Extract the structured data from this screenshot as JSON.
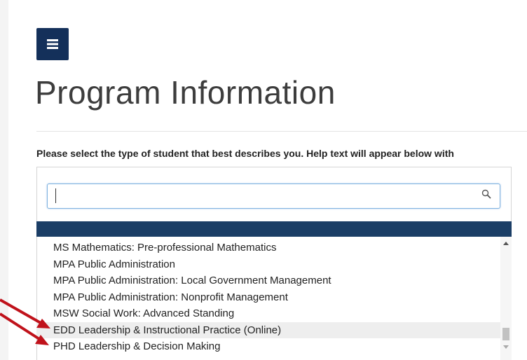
{
  "header": {
    "menu_icon": "hamburger-menu-icon",
    "title": "Program Information"
  },
  "form": {
    "prompt": "Please select the type of student that best describes you. Help text will appear below with",
    "search": {
      "value": "",
      "placeholder": "",
      "icon": "search-icon"
    }
  },
  "dropdown": {
    "items": [
      "MS Mathematics: Pre-professional Mathematics",
      "MPA Public Administration",
      "MPA Public Administration: Local Government Management",
      "MPA Public Administration: Nonprofit Management",
      "MSW Social Work: Advanced Standing",
      "EDD Leadership & Instructional Practice (Online)",
      "PHD Leadership & Decision Making"
    ],
    "hovered_index": 5
  },
  "colors": {
    "menu_button": "#14305a",
    "highlight_bar": "#1b3e66",
    "annotation_arrow": "#c0121b"
  }
}
